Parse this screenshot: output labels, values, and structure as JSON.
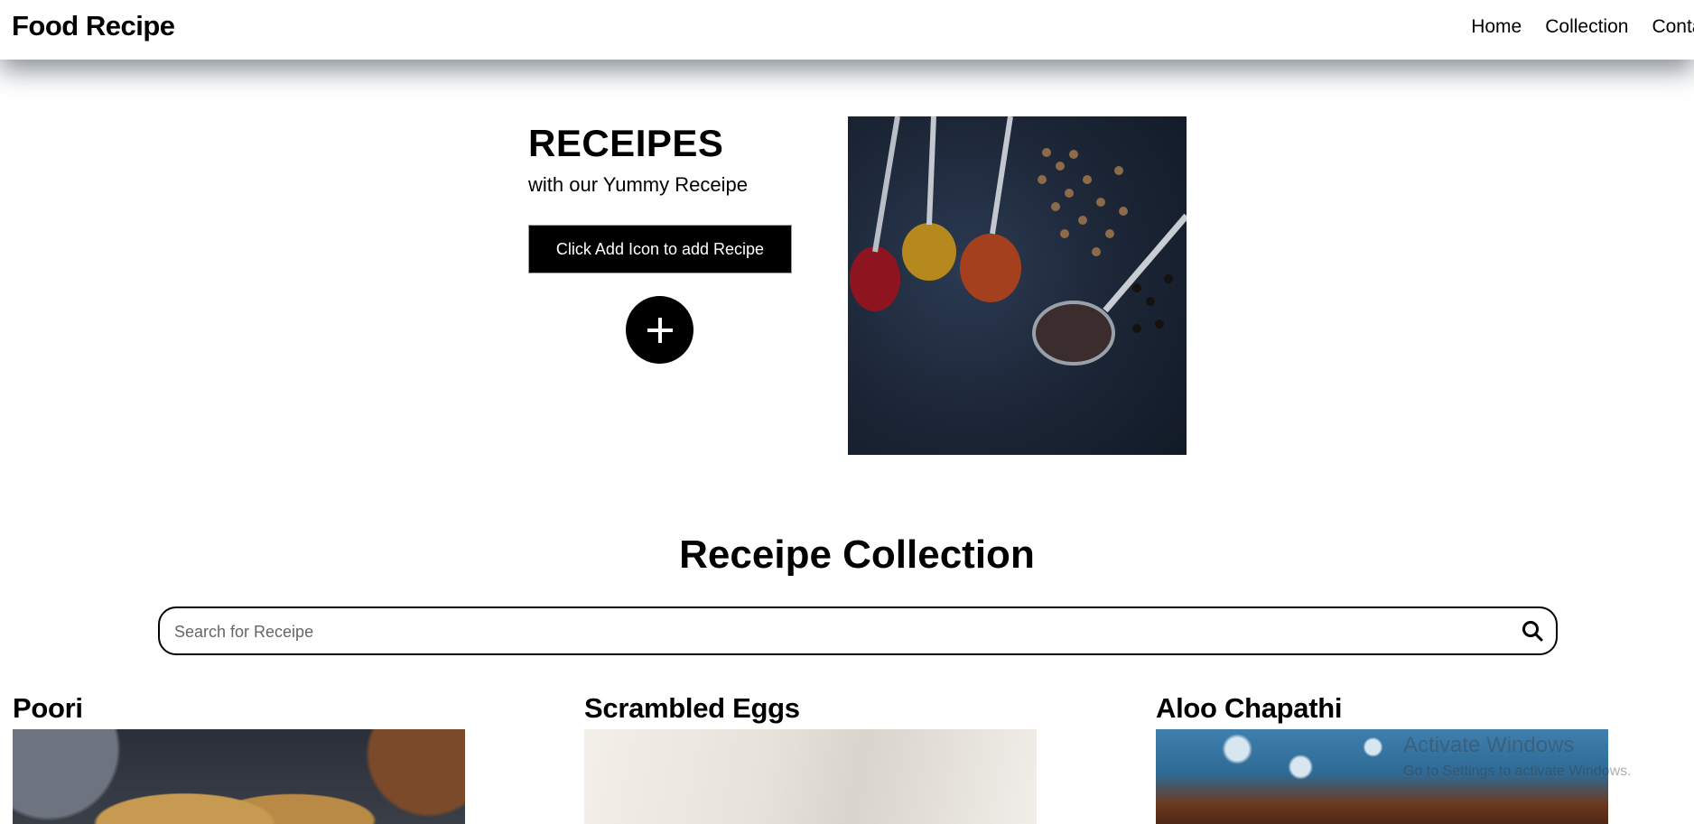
{
  "header": {
    "brand": "Food Recipe",
    "nav": [
      "Home",
      "Collection",
      "Contac"
    ]
  },
  "hero": {
    "title": "RECEIPES",
    "subtitle": "with our Yummy Receipe",
    "banner_label": "Click Add Icon to add Recipe",
    "add_icon": "plus-icon",
    "image_alt": "spices in spoons"
  },
  "collection": {
    "title": "Receipe Collection",
    "search_placeholder": "Search for Receipe",
    "search_icon": "search-icon",
    "cards": [
      {
        "title": "Poori"
      },
      {
        "title": "Scrambled Eggs"
      },
      {
        "title": "Aloo Chapathi"
      }
    ]
  },
  "watermark": {
    "title": "Activate Windows",
    "subtitle": "Go to Settings to activate Windows."
  }
}
